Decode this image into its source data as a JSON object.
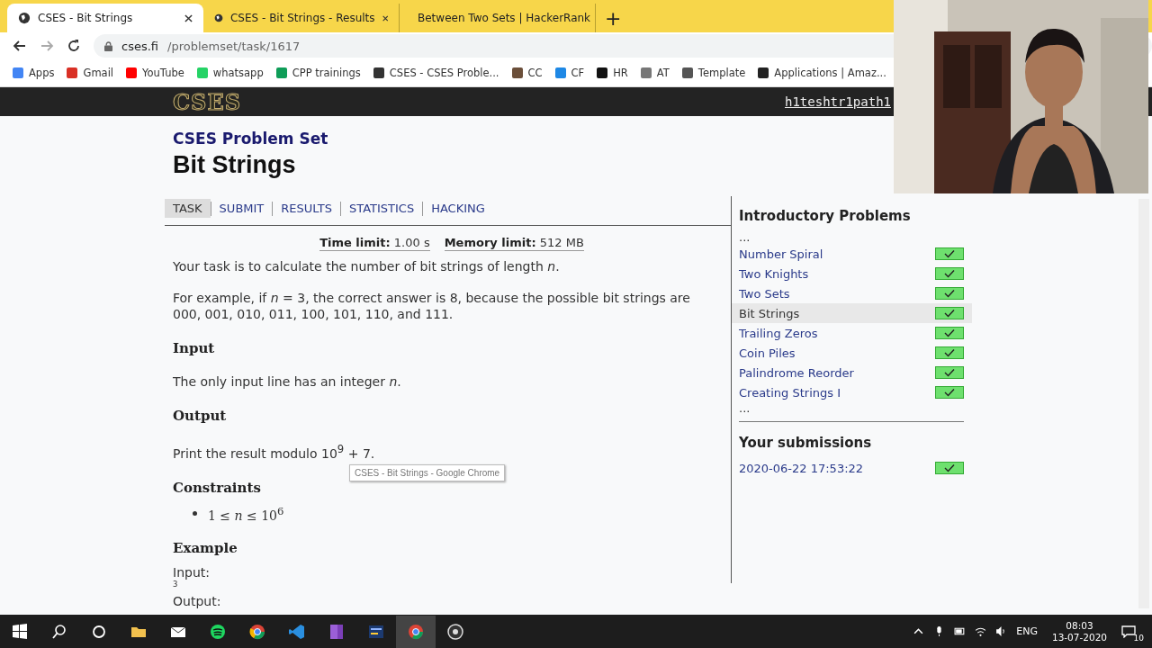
{
  "browser": {
    "tabs": [
      {
        "title": "CSES - Bit Strings",
        "selected": true,
        "kind": "globe"
      },
      {
        "title": "CSES - Bit Strings - Results",
        "selected": false,
        "kind": "globe"
      },
      {
        "title": "Between Two Sets | HackerRank",
        "selected": false,
        "kind": "hr"
      }
    ],
    "new_tab": "+",
    "url": {
      "host": "cses.fi",
      "path": "/problemset/task/1617"
    },
    "bookmarks": [
      {
        "label": "Apps",
        "color": "#4285f4"
      },
      {
        "label": "Gmail",
        "color": "#d93025"
      },
      {
        "label": "YouTube",
        "color": "#ff0000"
      },
      {
        "label": "whatsapp",
        "color": "#25d366"
      },
      {
        "label": "CPP trainings",
        "color": "#0f9d58"
      },
      {
        "label": "CSES - CSES Proble...",
        "color": "#333333"
      },
      {
        "label": "CC",
        "color": "#6b4f3a"
      },
      {
        "label": "CF",
        "color": "#1e88e5"
      },
      {
        "label": "HR",
        "color": "#111111"
      },
      {
        "label": "AT",
        "color": "#777777"
      },
      {
        "label": "Template",
        "color": "#555555"
      },
      {
        "label": "Applications | Amaz...",
        "color": "#222222"
      }
    ]
  },
  "site": {
    "logo": "CSES",
    "user": "h1teshtr1path1",
    "section": "CSES Problem Set",
    "title": "Bit Strings",
    "nav": [
      {
        "label": "TASK",
        "selected": true
      },
      {
        "label": "SUBMIT",
        "selected": false
      },
      {
        "label": "RESULTS",
        "selected": false
      },
      {
        "label": "STATISTICS",
        "selected": false
      },
      {
        "label": "HACKING",
        "selected": false
      }
    ],
    "limits": [
      {
        "label": "Time limit:",
        "value": "1.00 s"
      },
      {
        "label": "Memory limit:",
        "value": "512 MB"
      }
    ],
    "body": [
      {
        "kind": "p",
        "text": "Your task is to calculate the number of bit strings of length *n*."
      },
      {
        "kind": "p",
        "text": "For example, if *n* = 3, the correct answer is 8, because the possible bit strings are 000, 001, 010, 011, 100, 101, 110, and 111."
      },
      {
        "kind": "h",
        "text": "Input"
      },
      {
        "kind": "p",
        "text": "The only input line has an integer *n*."
      },
      {
        "kind": "h",
        "text": "Output"
      },
      {
        "kind": "p",
        "text": "Print the result modulo 10$^{9}$ + 7."
      },
      {
        "kind": "h",
        "text": "Constraints"
      },
      {
        "kind": "li",
        "text": "1 ≤ *n* ≤ 10$^{6}$"
      },
      {
        "kind": "h",
        "text": "Example"
      },
      {
        "kind": "label",
        "text": "Input:"
      },
      {
        "kind": "code",
        "text": "3"
      },
      {
        "kind": "label",
        "text": "Output:"
      }
    ],
    "sidebar": {
      "title": "Introductory Problems",
      "before": "...",
      "after": "...",
      "problems": [
        {
          "name": "Number Spiral",
          "selected": false,
          "solved": true
        },
        {
          "name": "Two Knights",
          "selected": false,
          "solved": true
        },
        {
          "name": "Two Sets",
          "selected": false,
          "solved": true
        },
        {
          "name": "Bit Strings",
          "selected": true,
          "solved": true
        },
        {
          "name": "Trailing Zeros",
          "selected": false,
          "solved": true
        },
        {
          "name": "Coin Piles",
          "selected": false,
          "solved": true
        },
        {
          "name": "Palindrome Reorder",
          "selected": false,
          "solved": true
        },
        {
          "name": "Creating Strings I",
          "selected": false,
          "solved": true
        }
      ],
      "submissions_title": "Your submissions",
      "submissions": [
        {
          "time": "2020-06-22 17:53:22",
          "accepted": true
        }
      ]
    }
  },
  "tooltip": "CSES - Bit Strings - Google Chrome",
  "taskbar": {
    "language": "ENG",
    "time": "08:03",
    "date": "13-07-2020",
    "notifications": "10"
  }
}
